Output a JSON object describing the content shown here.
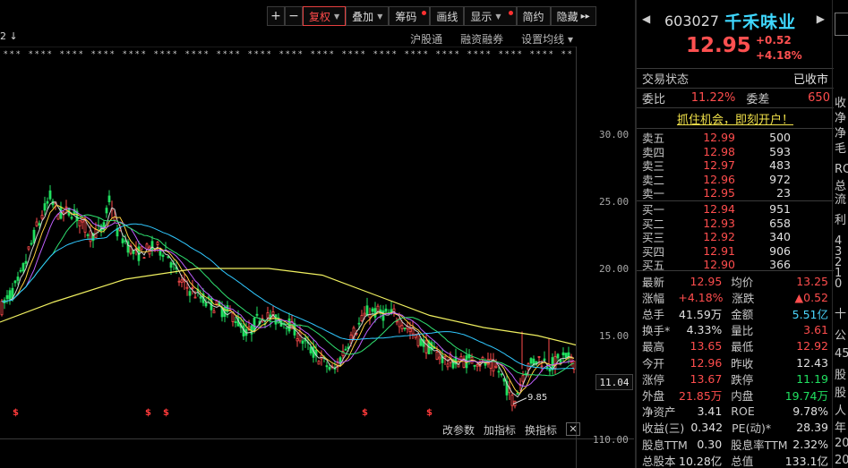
{
  "toolbar": {
    "plus": "+",
    "minus": "−",
    "restore_rights": "复权",
    "overlay": "叠加",
    "chips": "筹码",
    "draw": "画线",
    "display": "显示",
    "simple": "简约",
    "hide": "隐藏",
    "forward": "▸▸"
  },
  "chart_top": {
    "left_marker": "2 ↓",
    "links": [
      "沪股通",
      "融资融券",
      "设置均线"
    ],
    "dropdown": "▾"
  },
  "y_axis": {
    "labels": [
      "30.00",
      "25.00",
      "20.00",
      "15.00"
    ],
    "current_price": "11.04",
    "volume_label": "110.00"
  },
  "low_annotation": "9.85",
  "indicator_bar": {
    "items": [
      "改参数",
      "加指标",
      "换指标"
    ],
    "close": "✕"
  },
  "stock": {
    "code": "603027",
    "name": "千禾味业",
    "nav_left": "◀",
    "nav_right": "▶",
    "price": "12.95",
    "change": "+0.52",
    "change_pct": "+4.18%",
    "status_label": "交易状态",
    "status_value": "已收市",
    "wei_bi_label": "委比",
    "wei_bi": "11.22%",
    "wei_cha_label": "委差",
    "wei_cha": "650",
    "promo": "抓住机会，即刻开户！"
  },
  "orderbook": {
    "asks": [
      {
        "label": "卖五",
        "price": "12.99",
        "vol": "500"
      },
      {
        "label": "卖四",
        "price": "12.98",
        "vol": "593"
      },
      {
        "label": "卖三",
        "price": "12.97",
        "vol": "483"
      },
      {
        "label": "卖二",
        "price": "12.96",
        "vol": "972"
      },
      {
        "label": "卖一",
        "price": "12.95",
        "vol": "23"
      }
    ],
    "bids": [
      {
        "label": "买一",
        "price": "12.94",
        "vol": "951"
      },
      {
        "label": "买二",
        "price": "12.93",
        "vol": "658"
      },
      {
        "label": "买三",
        "price": "12.92",
        "vol": "340"
      },
      {
        "label": "买四",
        "price": "12.91",
        "vol": "906"
      },
      {
        "label": "买五",
        "price": "12.90",
        "vol": "366"
      }
    ]
  },
  "stats": [
    {
      "k1": "最新",
      "v1": "12.95",
      "c1": "red",
      "k2": "均价",
      "v2": "13.25",
      "c2": "red"
    },
    {
      "k1": "涨幅",
      "v1": "+4.18%",
      "c1": "red",
      "k2": "涨跌",
      "v2": "▲0.52",
      "c2": "red"
    },
    {
      "k1": "总手",
      "v1": "41.59万",
      "c1": "white",
      "k2": "金额",
      "v2": "5.51亿",
      "c2": "cyan"
    },
    {
      "k1": "换手*",
      "v1": "4.33%",
      "c1": "white",
      "k2": "量比",
      "v2": "3.61",
      "c2": "red"
    },
    {
      "k1": "最高",
      "v1": "13.65",
      "c1": "red",
      "k2": "最低",
      "v2": "12.92",
      "c2": "red"
    },
    {
      "k1": "今开",
      "v1": "12.96",
      "c1": "red",
      "k2": "昨收",
      "v2": "12.43",
      "c2": "white"
    },
    {
      "k1": "涨停",
      "v1": "13.67",
      "c1": "red",
      "k2": "跌停",
      "v2": "11.19",
      "c2": "green"
    },
    {
      "k1": "外盘",
      "v1": "21.85万",
      "c1": "red",
      "k2": "内盘",
      "v2": "19.74万",
      "c2": "green"
    },
    {
      "k1": "净资产",
      "v1": "3.41",
      "c1": "white",
      "k2": "ROE",
      "v2": "9.78%",
      "c2": "white"
    },
    {
      "k1": "收益(三)",
      "v1": "0.342",
      "c1": "white",
      "k2": "PE(动)*",
      "v2": "28.39",
      "c2": "white"
    },
    {
      "k1": "股息TTM",
      "v1": "0.30",
      "c1": "white",
      "k2": "股息率TTM",
      "v2": "2.32%",
      "c2": "white"
    },
    {
      "k1": "总股本",
      "v1": "10.28亿",
      "c1": "white",
      "k2": "总值",
      "v2": "133.1亿",
      "c2": "white"
    }
  ],
  "far_right": [
    "收",
    "净",
    "净",
    "毛",
    "RO",
    "总",
    "流",
    "利",
    "4",
    "3",
    "2",
    "1",
    "0",
    "十",
    "公",
    "45",
    "股",
    "股",
    "人",
    "年",
    "20",
    "20"
  ],
  "colors": {
    "up": "#ff4d4d",
    "down": "#20e060",
    "accent": "#3fd8ff",
    "ma_yellow": "#f0f060",
    "ma_cyan": "#30c8ff",
    "ma_purple": "#c060ff",
    "ma_white": "#d0d0d0"
  }
}
